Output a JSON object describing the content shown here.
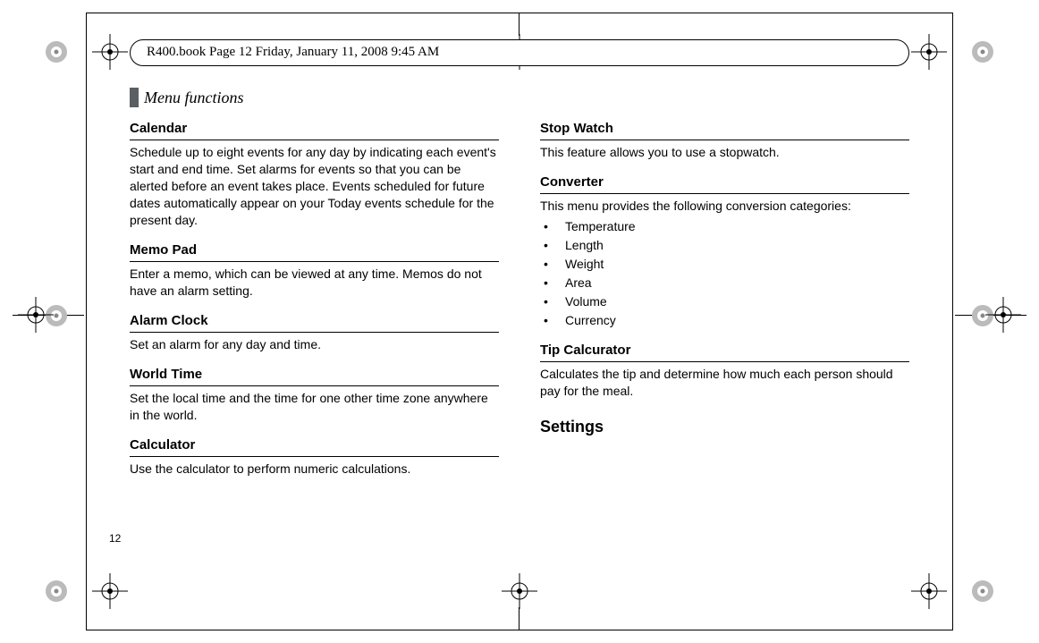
{
  "running_header": "R400.book  Page 12  Friday, January 11, 2008  9:45 AM",
  "chapter_label": "Menu functions",
  "page_number": "12",
  "left": {
    "calendar": {
      "title": "Calendar",
      "body": "Schedule up to eight events for any day by indicating each event's start and end time. Set alarms for events so that you can be alerted before an event takes place. Events scheduled for future dates automatically appear on your Today events schedule for the present day."
    },
    "memo_pad": {
      "title": "Memo Pad",
      "body": "Enter a memo, which can be viewed at any time. Memos do not have an alarm setting."
    },
    "alarm_clock": {
      "title": "Alarm Clock",
      "body": "Set an alarm for any day and time."
    },
    "world_time": {
      "title": "World Time",
      "body": "Set the local time and the time for one other time zone anywhere in the world."
    },
    "calculator": {
      "title": "Calculator",
      "body": "Use the calculator to perform numeric calculations."
    }
  },
  "right": {
    "stop_watch": {
      "title": "Stop Watch",
      "body": "This feature allows you to use a stopwatch."
    },
    "converter": {
      "title": "Converter",
      "body": "This menu provides the following conversion categories:",
      "items": [
        "Temperature",
        "Length",
        "Weight",
        "Area",
        "Volume",
        "Currency"
      ]
    },
    "tip_calc": {
      "title": "Tip Calcurator",
      "body": "Calculates the tip and determine how much each person should pay for the meal."
    },
    "settings": {
      "title": "Settings"
    }
  }
}
